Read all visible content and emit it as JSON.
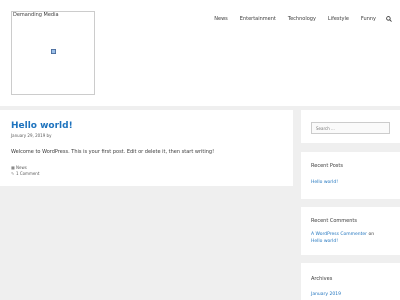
{
  "site": {
    "title": "Demanding Media"
  },
  "nav": {
    "items": [
      "News",
      "Entertainment",
      "Technology",
      "Lifestyle",
      "Funny"
    ],
    "search_icon": "magnifier-icon"
  },
  "post": {
    "title": "Hello world!",
    "date": "January 29, 2019",
    "by": "by",
    "body": "Welcome to WordPress. This is your first post. Edit or delete it, then start writing!",
    "category": "News",
    "comments": "1 Comment"
  },
  "sidebar": {
    "search_placeholder": "Search ...",
    "recent_posts": {
      "title": "Recent Posts",
      "items": [
        "Hello world!"
      ]
    },
    "recent_comments": {
      "title": "Recent Comments",
      "author": "A WordPress Commenter",
      "on": "on",
      "post": "Hello world!"
    },
    "archives": {
      "title": "Archives",
      "items": [
        "January 2019"
      ]
    }
  },
  "colors": {
    "link": "#1e73be",
    "background": "#efefef",
    "text": "#3a3a3a"
  }
}
